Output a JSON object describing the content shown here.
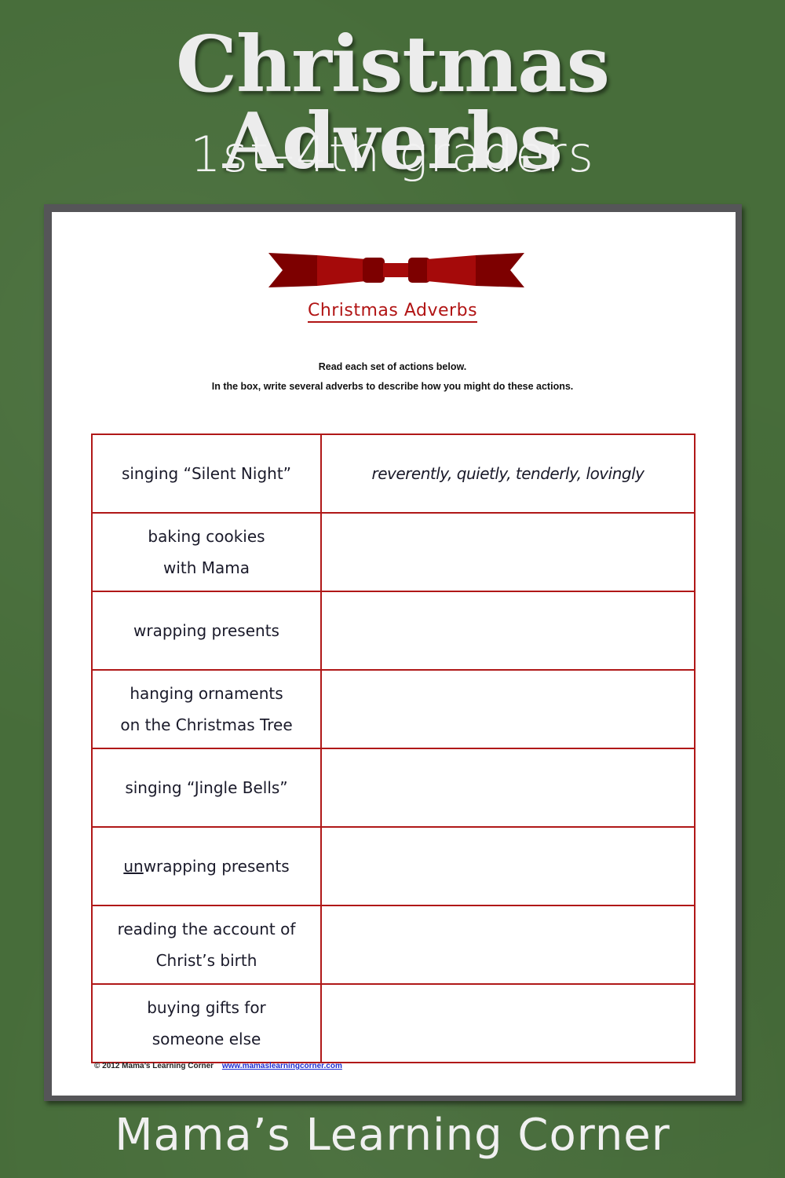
{
  "header": {
    "title": "Christmas Adverbs",
    "subtitle": "1st–4th graders"
  },
  "worksheet": {
    "decoration": "red-bow-ribbon",
    "title": "Christmas Adverbs",
    "instructions": [
      "Read each set of actions below.",
      "In the box, write several adverbs to describe how you might do these actions."
    ],
    "rows": [
      {
        "action_lines": [
          "singing “Silent Night”"
        ],
        "answer": "reverently, quietly, tenderly, lovingly"
      },
      {
        "action_lines": [
          "baking cookies",
          "with Mama"
        ],
        "answer": ""
      },
      {
        "action_lines": [
          "wrapping presents"
        ],
        "answer": ""
      },
      {
        "action_lines": [
          "hanging ornaments",
          "on the Christmas Tree"
        ],
        "answer": ""
      },
      {
        "action_lines": [
          "singing “Jingle Bells”"
        ],
        "answer": ""
      },
      {
        "action_prefix_underlined": "un",
        "action_lines": [
          "wrapping presents"
        ],
        "answer": ""
      },
      {
        "action_lines": [
          "reading the account of",
          "Christ’s birth"
        ],
        "answer": ""
      },
      {
        "action_lines": [
          "buying gifts for",
          "someone else"
        ],
        "answer": ""
      }
    ],
    "copyright": "© 2012 Mama’s Learning Corner",
    "link": "www.mamaslearningcorner.com"
  },
  "footer": {
    "brand": "Mama’s Learning Corner"
  },
  "colors": {
    "background_green": "#476d3a",
    "frame_gray": "#555558",
    "table_border_red": "#b01818",
    "bow_dark": "#7d0000",
    "bow_mid": "#a50a0a"
  }
}
